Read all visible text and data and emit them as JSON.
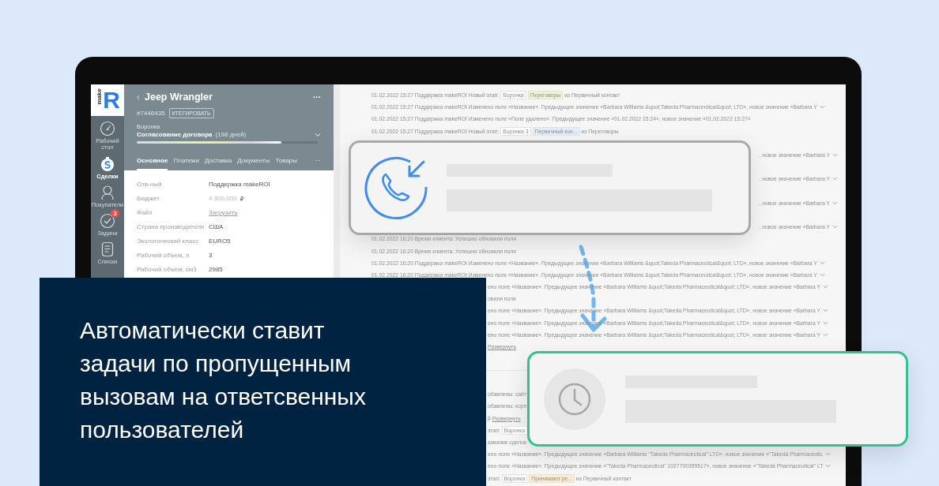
{
  "logo": {
    "small": "make",
    "big": "R"
  },
  "nav": [
    {
      "label": "Рабочий стол",
      "selected": false
    },
    {
      "label": "Сделки",
      "selected": true
    },
    {
      "label": "Покупатели",
      "selected": false
    },
    {
      "label": "Задачи",
      "selected": false,
      "badge": "3"
    },
    {
      "label": "Списки",
      "selected": false
    }
  ],
  "deal": {
    "back": "‹",
    "title": "Jeep Wrangler",
    "menu": "···",
    "id": "#7446435",
    "tag": "#ТЕГИРОВАТЬ",
    "funnel_label": "Воронка",
    "stage": "Согласование договора",
    "stage_days": "(198 дней)",
    "level": 0.8,
    "tabs": [
      {
        "label": "Основное",
        "selected": true
      },
      {
        "label": "Платежи",
        "selected": false
      },
      {
        "label": "Доставка",
        "selected": false
      },
      {
        "label": "Документы",
        "selected": false
      },
      {
        "label": "Товары",
        "selected": false
      }
    ],
    "tabs_more": "···",
    "fields": [
      {
        "label": "Отв-ный",
        "value": "Поддержка makeROI",
        "kind": "text"
      },
      {
        "label": "Бюджет",
        "value": "4 300 000",
        "currency": "₽",
        "kind": "money"
      },
      {
        "label": "Файл",
        "value": "Загрузить",
        "kind": "link"
      },
      {
        "label": "Страна производителя",
        "value": "США",
        "kind": "text"
      },
      {
        "label": "Экологический класс",
        "value": "EURO5",
        "kind": "text"
      },
      {
        "label": "Рабочий объем, л",
        "value": "3",
        "kind": "text"
      },
      {
        "label": "Рабочий объем, см3",
        "value": "2985",
        "kind": "text"
      }
    ]
  },
  "log": [
    {
      "kind": "full",
      "parts": [
        {
          "kind": "text",
          "t": "01.02.2022 15:27 Поддержка makeROI Новый этап:"
        },
        {
          "kind": "tag",
          "t": "Воронка",
          "color": "#ffffff"
        },
        {
          "kind": "tag",
          "t": "Переговоры",
          "color": "#eef5d3"
        },
        {
          "kind": "text",
          "t": "из Первичный контакт"
        }
      ]
    },
    {
      "kind": "full",
      "chevron": true,
      "parts": [
        {
          "kind": "text",
          "t": "01.02.2022 15:27 Поддержка makeROI Изменено поле «Название». Предыдущее значение «Barbara Williams &quot;Takeda Pharmaceutical&quot; LTD», новое значение «Barbara Y"
        }
      ]
    },
    {
      "kind": "full",
      "parts": [
        {
          "kind": "text",
          "t": "01.02.2022 15:27 Поддержка makeROI Изменено поле «Поле удалено». Предыдущее значение «01.02.2022 15:24», новое значение «01.02.2022 15:27»"
        }
      ]
    },
    {
      "kind": "full",
      "parts": [
        {
          "kind": "text",
          "t": "01.02.2022 15:27 Поддержка makeROI Новый этап:"
        },
        {
          "kind": "tag",
          "t": "Воронка 3",
          "color": "#ffffff"
        },
        {
          "kind": "tag",
          "t": "Первичный кон...",
          "color": "#e2edf9"
        },
        {
          "kind": "text",
          "t": "из Переговоры"
        }
      ]
    },
    {
      "kind": "tail",
      "chevron": true,
      "parts": [
        {
          "kind": "text",
          "t": ", новое значение «Barbara Y"
        }
      ]
    },
    {
      "kind": "tail",
      "chevron": true,
      "parts": [
        {
          "kind": "text",
          "t": ", новое значение «Barbara Y"
        }
      ]
    },
    {
      "kind": "tail",
      "chevron": true,
      "parts": [
        {
          "kind": "text",
          "t": ", новое значение «Barbara Y"
        }
      ]
    },
    {
      "kind": "tail",
      "chevron": true,
      "parts": [
        {
          "kind": "text",
          "t": ", новое значение «Barbara Y"
        }
      ]
    },
    {
      "kind": "full",
      "parts": [
        {
          "kind": "text",
          "t": "01.02.2022 16:20 Время клиента: Успешно обновили поля"
        }
      ]
    },
    {
      "kind": "full",
      "parts": [
        {
          "kind": "text",
          "t": "01.02.2022 16:20 Время клиента: Успешно обновили поля"
        }
      ]
    },
    {
      "kind": "full",
      "chevron": true,
      "parts": [
        {
          "kind": "text",
          "t": "01.02.2022 16:20 Поддержка makeROI Изменено поле «Название». Предыдущее значение «Barbara Williams &quot;Takeda Pharmaceutical&quot; LTD», новое значение «Barbara Y"
        }
      ]
    },
    {
      "kind": "full",
      "chevron": true,
      "parts": [
        {
          "kind": "text",
          "t": "01.02.2022 16:20 Поддержка makeROI Изменено поле «Название». Предыдущее значение «Barbara Williams &quot;Takeda Pharmaceutical&quot; LTD», новое значение «Barbara Y"
        }
      ]
    },
    {
      "kind": "cut",
      "chevron": true,
      "parts": [
        {
          "kind": "text",
          "t": "ено поле «Название». Предыдущее значение «Barbara Williams &quot;Takeda Pharmaceutical&quot; LTD», новое значение «Barbara Y"
        }
      ]
    },
    {
      "kind": "cut",
      "parts": [
        {
          "kind": "text",
          "t": "овили поля"
        }
      ]
    },
    {
      "kind": "cut",
      "chevron": true,
      "parts": [
        {
          "kind": "text",
          "t": "ено поле «Название». Предыдущее значение «Barbara Williams &quot;Takeda Pharmaceutical&quot; LTD», новое значение «Barbara Y"
        }
      ]
    },
    {
      "kind": "cut",
      "chevron": true,
      "parts": [
        {
          "kind": "text",
          "t": "ено поле «Название». Предыдущее значение «Barbara Williams &quot;Takeda Pharmaceutical&quot; LTD», новое значение «Barbara Y"
        }
      ]
    },
    {
      "kind": "cut",
      "chevron": true,
      "parts": [
        {
          "kind": "text",
          "t": "ено поле «Название». Предыдущее значение «Barbara Williams &quot;Takeda Pharmaceutical&quot; LTD», новое значение «Barbara Y"
        }
      ]
    },
    {
      "kind": "cut",
      "parts": [
        {
          "kind": "link",
          "t": "Развернуть"
        }
      ]
    },
    {
      "kind": "divider"
    },
    {
      "kind": "cut",
      "parts": [
        {
          "kind": "text",
          "t": "обавлены: сайт"
        }
      ]
    },
    {
      "kind": "cut",
      "parts": [
        {
          "kind": "text",
          "t": "обавлены: корп"
        }
      ]
    },
    {
      "kind": "cut",
      "parts": [
        {
          "kind": "text",
          "t": "й"
        },
        {
          "kind": "link",
          "t": "Развернуть"
        }
      ]
    },
    {
      "kind": "cut",
      "parts": [
        {
          "kind": "text",
          "t": "этап:"
        },
        {
          "kind": "tag",
          "t": "Воронка",
          "color": "#ffffff"
        }
      ]
    },
    {
      "kind": "cut",
      "parts": [
        {
          "kind": "text",
          "t": "азвание сделок"
        }
      ]
    },
    {
      "kind": "cut",
      "chevron": true,
      "parts": [
        {
          "kind": "text",
          "t": "ено поле «Название». Предыдущее значение «Barbara Williams \"Takeda Pharmaceutical\" LTD», новое значение «\"Takeda Pharmaceutic"
        }
      ]
    },
    {
      "kind": "cut",
      "chevron": true,
      "parts": [
        {
          "kind": "text",
          "t": "ено поле «Название». Предыдущее значение «\"Takeda Pharmaceutical\" 1027700399517», новое значение «\"Takeda Pharmaceutical\" LT"
        }
      ]
    },
    {
      "kind": "cut",
      "parts": [
        {
          "kind": "text",
          "t": "этап:"
        },
        {
          "kind": "tag",
          "t": "Воронка",
          "color": "#ffffff"
        },
        {
          "kind": "tag",
          "t": "Принимают ре...",
          "color": "#fbecd0"
        },
        {
          "kind": "text",
          "t": "из Первичный контакт"
        }
      ]
    }
  ],
  "banner": {
    "text": "Автоматически ставит задачи по пропущенным вызовам на ответсвенных пользователей"
  }
}
